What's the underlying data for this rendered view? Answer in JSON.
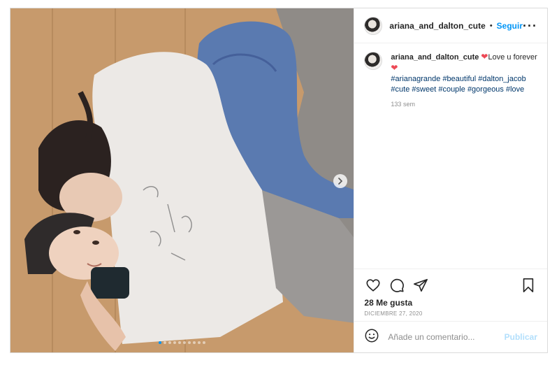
{
  "post": {
    "username": "ariana_and_dalton_cute",
    "separator": "•",
    "follow_label": "Seguir",
    "more_label": "•••"
  },
  "caption": {
    "username": "ariana_and_dalton_cute",
    "text_1": "Love u forever",
    "hashtags": [
      "#arianagrande",
      "#beautiful",
      "#dalton_jacob",
      "#cute",
      "#sweet",
      "#couple",
      "#gorgeous",
      "#love"
    ],
    "time": "133 sem"
  },
  "stats": {
    "likes": "28 Me gusta",
    "date": "DICIEMBRE 27, 2020"
  },
  "comment": {
    "placeholder": "Añade un comentario...",
    "publish_label": "Publicar"
  },
  "carousel": {
    "slide_count": 10,
    "active_index": 0
  },
  "icons": {
    "like": "heart-icon",
    "comment": "comment-icon",
    "share": "paper-plane-icon",
    "save": "bookmark-icon",
    "emoji": "emoji-icon",
    "next": "chevron-right-icon"
  },
  "colors": {
    "accent": "#0095f6",
    "heart": "#ed4956",
    "hashtag": "#00376b",
    "publish_disabled": "#b2dffc"
  }
}
